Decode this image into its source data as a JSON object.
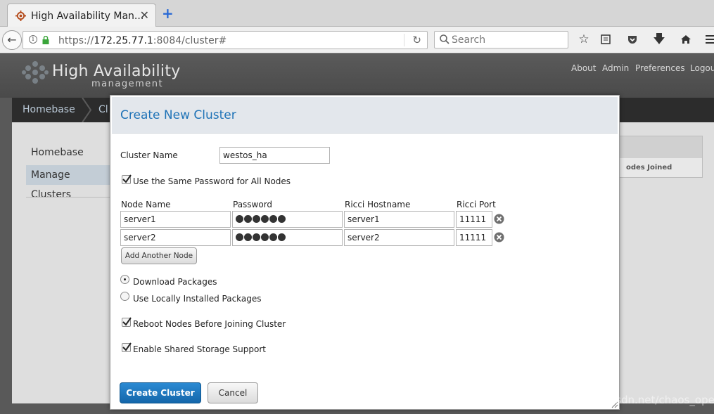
{
  "browser": {
    "tab_title": "High Availability Man...",
    "close_glyph": "✕",
    "new_tab_glyph": "+",
    "url_scheme": "https://",
    "url_host": "172.25.77.1",
    "url_rest": ":8084/cluster#",
    "search_placeholder": "Search"
  },
  "header": {
    "logo_title": "High Availability",
    "logo_subtitle": "management",
    "links": [
      "About",
      "Admin",
      "Preferences",
      "Logout"
    ]
  },
  "breadcrumb": {
    "home": "Homebase",
    "current": "Cl"
  },
  "sidebar": {
    "items": [
      "Homebase",
      "Manage Clusters"
    ]
  },
  "background_table": {
    "column": "odes Joined"
  },
  "modal": {
    "title": "Create New Cluster",
    "cluster_name_label": "Cluster Name",
    "cluster_name_value": "westos_ha",
    "same_password_label": "Use the Same Password for All Nodes",
    "same_password_checked": true,
    "columns": [
      "Node Name",
      "Password",
      "Ricci Hostname",
      "Ricci Port"
    ],
    "nodes": [
      {
        "name": "server1",
        "password_dots": 6,
        "hostname": "server1",
        "port": "11111"
      },
      {
        "name": "server2",
        "password_dots": 6,
        "hostname": "server2",
        "port": "11111"
      }
    ],
    "add_node_label": "Add Another Node",
    "package_options": [
      {
        "label": "Download Packages",
        "selected": true
      },
      {
        "label": "Use Locally Installed Packages",
        "selected": false
      }
    ],
    "reboot_label": "Reboot Nodes Before Joining Cluster",
    "reboot_checked": true,
    "shared_storage_label": "Enable Shared Storage Support",
    "shared_storage_checked": true,
    "create_label": "Create Cluster",
    "cancel_label": "Cancel"
  },
  "watermark": "https://blog.csdn.net/chaos_oper",
  "colors": {
    "accent": "#1f73b7",
    "primary_button": "#1b75bf",
    "header_bg": "#4f4f4f"
  }
}
